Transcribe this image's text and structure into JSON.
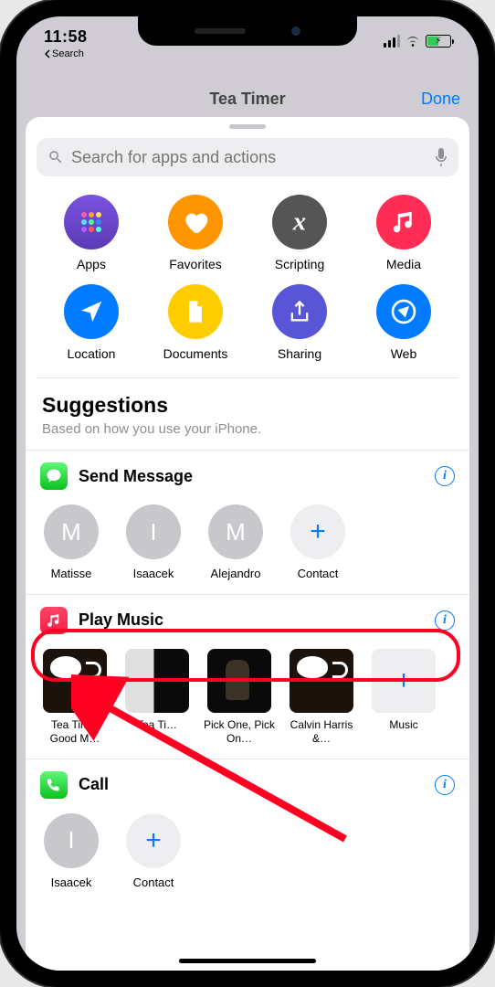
{
  "status": {
    "time": "11:58",
    "back_label": "Search"
  },
  "nav": {
    "title": "Tea Timer",
    "done": "Done"
  },
  "search": {
    "placeholder": "Search for apps and actions"
  },
  "categories": [
    {
      "id": "apps",
      "label": "Apps"
    },
    {
      "id": "favorites",
      "label": "Favorites"
    },
    {
      "id": "scripting",
      "label": "Scripting"
    },
    {
      "id": "media",
      "label": "Media"
    },
    {
      "id": "location",
      "label": "Location"
    },
    {
      "id": "documents",
      "label": "Documents"
    },
    {
      "id": "sharing",
      "label": "Sharing"
    },
    {
      "id": "web",
      "label": "Web"
    }
  ],
  "suggestions": {
    "title": "Suggestions",
    "subtitle": "Based on how you use your iPhone."
  },
  "send_message": {
    "title": "Send Message",
    "contacts": [
      {
        "initial": "M",
        "name": "Matisse"
      },
      {
        "initial": "I",
        "name": "Isaacek"
      },
      {
        "initial": "M",
        "name": "Alejandro"
      }
    ],
    "add_label": "Contact"
  },
  "play_music": {
    "title": "Play Music",
    "albums": [
      {
        "label": "Tea Time, Good M…"
      },
      {
        "label": "Tea Ti…"
      },
      {
        "label": "Pick One, Pick On…"
      },
      {
        "label": "Calvin Harris &…"
      }
    ],
    "add_label": "Music"
  },
  "call": {
    "title": "Call",
    "contacts": [
      {
        "initial": "I",
        "name": "Isaacek"
      }
    ],
    "add_label": "Contact"
  }
}
